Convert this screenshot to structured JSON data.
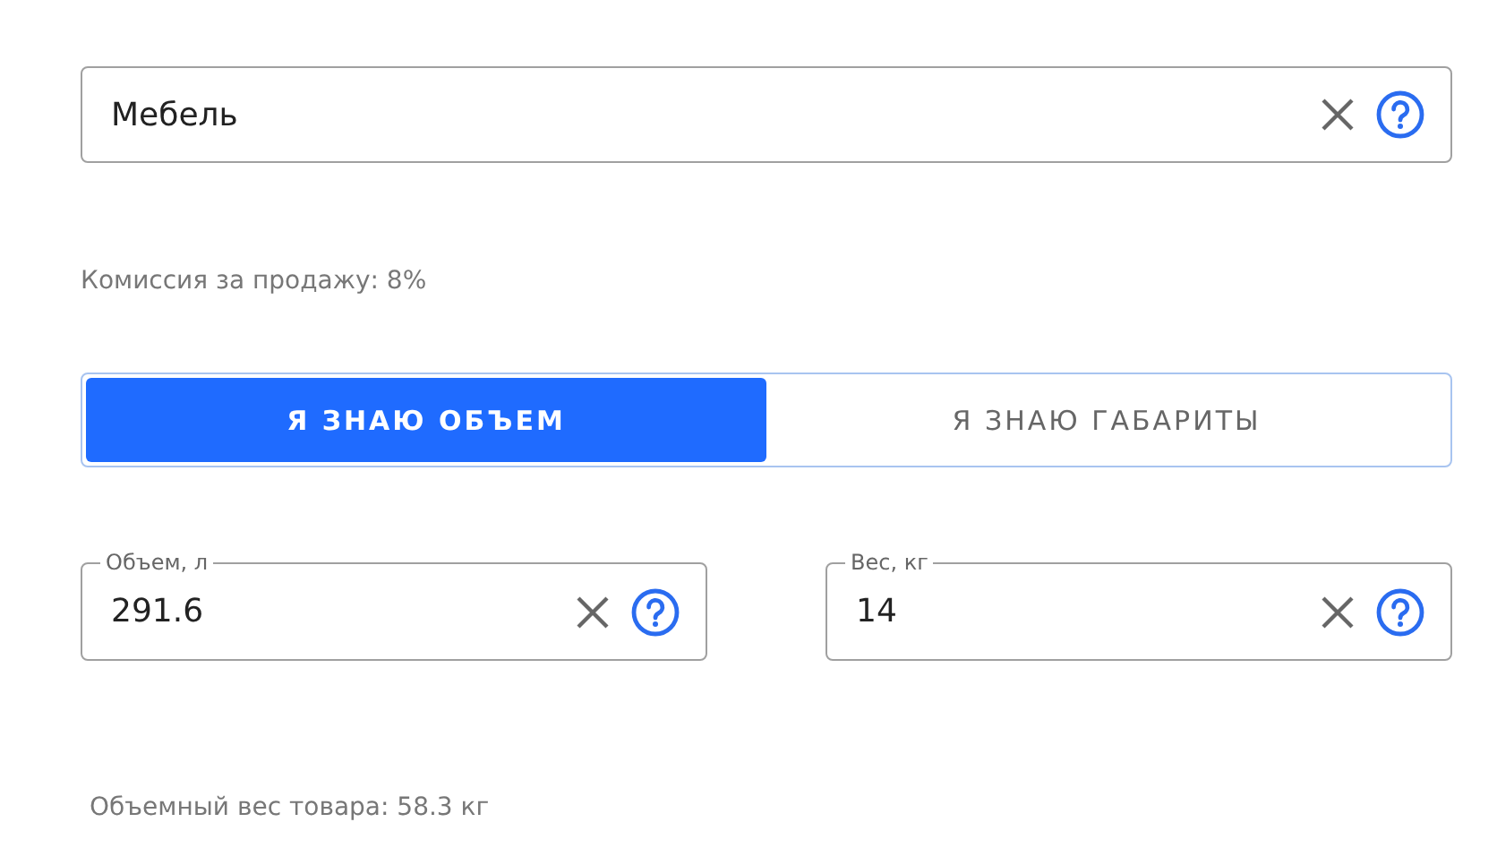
{
  "category_field": {
    "value": "Мебель"
  },
  "commission": "Комиссия за продажу: 8%",
  "mode_tabs": [
    {
      "label": "Я ЗНАЮ ОБЪЕМ",
      "selected": true
    },
    {
      "label": "Я ЗНАЮ ГАБАРИТЫ",
      "selected": false
    }
  ],
  "fields": [
    {
      "label": "Объем, л",
      "value": "291.6"
    },
    {
      "label": "Вес, кг",
      "value": "14"
    }
  ],
  "volumetric_weight": "Объемный вес товара: 58.3 кг"
}
